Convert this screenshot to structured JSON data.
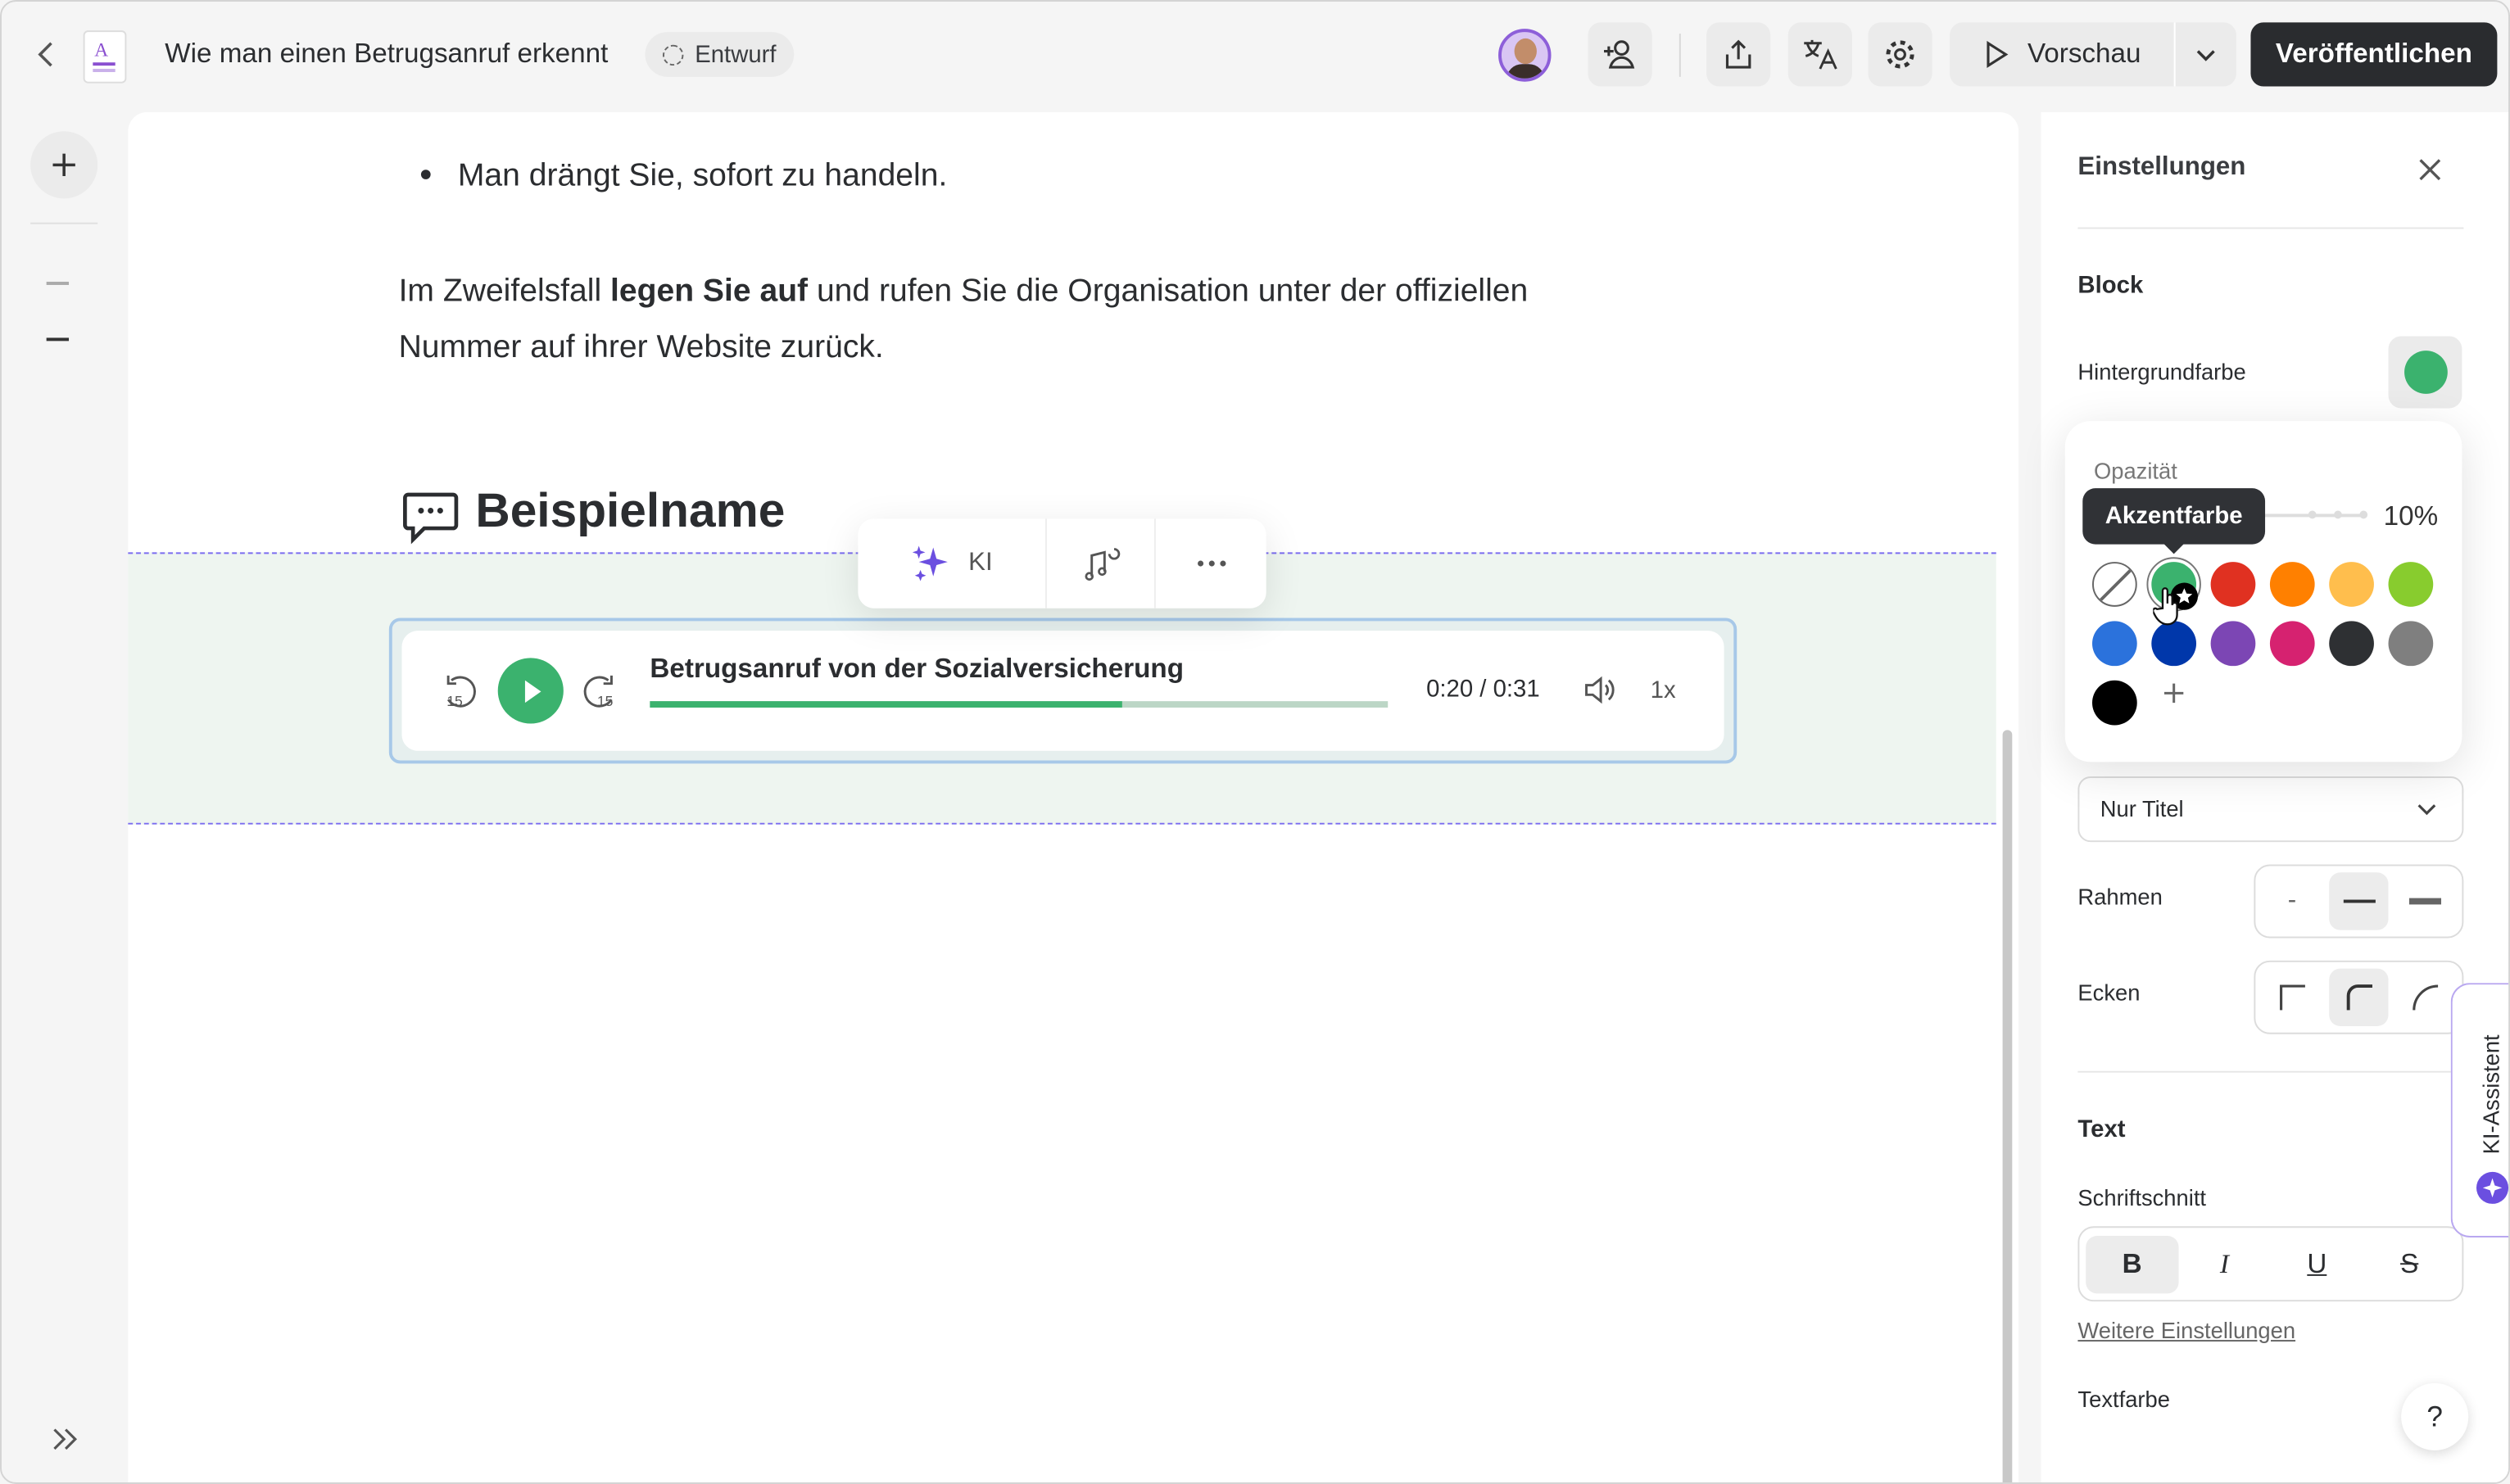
{
  "topbar": {
    "title": "Wie man einen Betrugsanruf erkennt",
    "status_badge": "Entwurf",
    "preview_label": "Vorschau",
    "publish_label": "Veröffentlichen"
  },
  "editor": {
    "bullet": "Man drängt Sie, sofort zu handeln.",
    "paragraph_before": "Im Zweifelsfall ",
    "paragraph_bold": "legen Sie auf",
    "paragraph_after": " und rufen Sie die Organisation unter der offiziellen",
    "paragraph_line2": "Nummer auf ihrer Website zurück.",
    "heading": "Beispielname",
    "block_toolbar": {
      "ai_label": "KI"
    },
    "audio": {
      "title": "Betrugsanruf von der Sozialversicherung",
      "time": "0:20 / 0:31",
      "speed": "1x",
      "progress_percent": 64,
      "skip_back": "15",
      "skip_forward": "15"
    }
  },
  "settings": {
    "title": "Einstellungen",
    "block_heading": "Block",
    "background_label": "Hintergrundfarbe",
    "background_color": "#3bb26e",
    "popover": {
      "opacity_label": "Opazität",
      "opacity_value": "10%",
      "opacity_percent": 10,
      "tooltip": "Akzentfarbe",
      "swatches": [
        "#3bb26e",
        "#e03121",
        "#ff8000",
        "#ffbe4d",
        "#88cc2e",
        "#2b72dc",
        "#0037aa",
        "#7c46b4",
        "#d62270",
        "#2e3033",
        "#7f7f7f",
        "#000000"
      ]
    },
    "title_mode": "Nur Titel",
    "border_label": "Rahmen",
    "border_none": "-",
    "corners_label": "Ecken",
    "text_heading": "Text",
    "font_style_label": "Schriftschnitt",
    "font_styles": [
      "B",
      "I",
      "U",
      "S"
    ],
    "more_settings": "Weitere Einstellungen",
    "text_color_label": "Textfarbe",
    "help": "?",
    "ai_assistant": "KI-Assistent"
  }
}
